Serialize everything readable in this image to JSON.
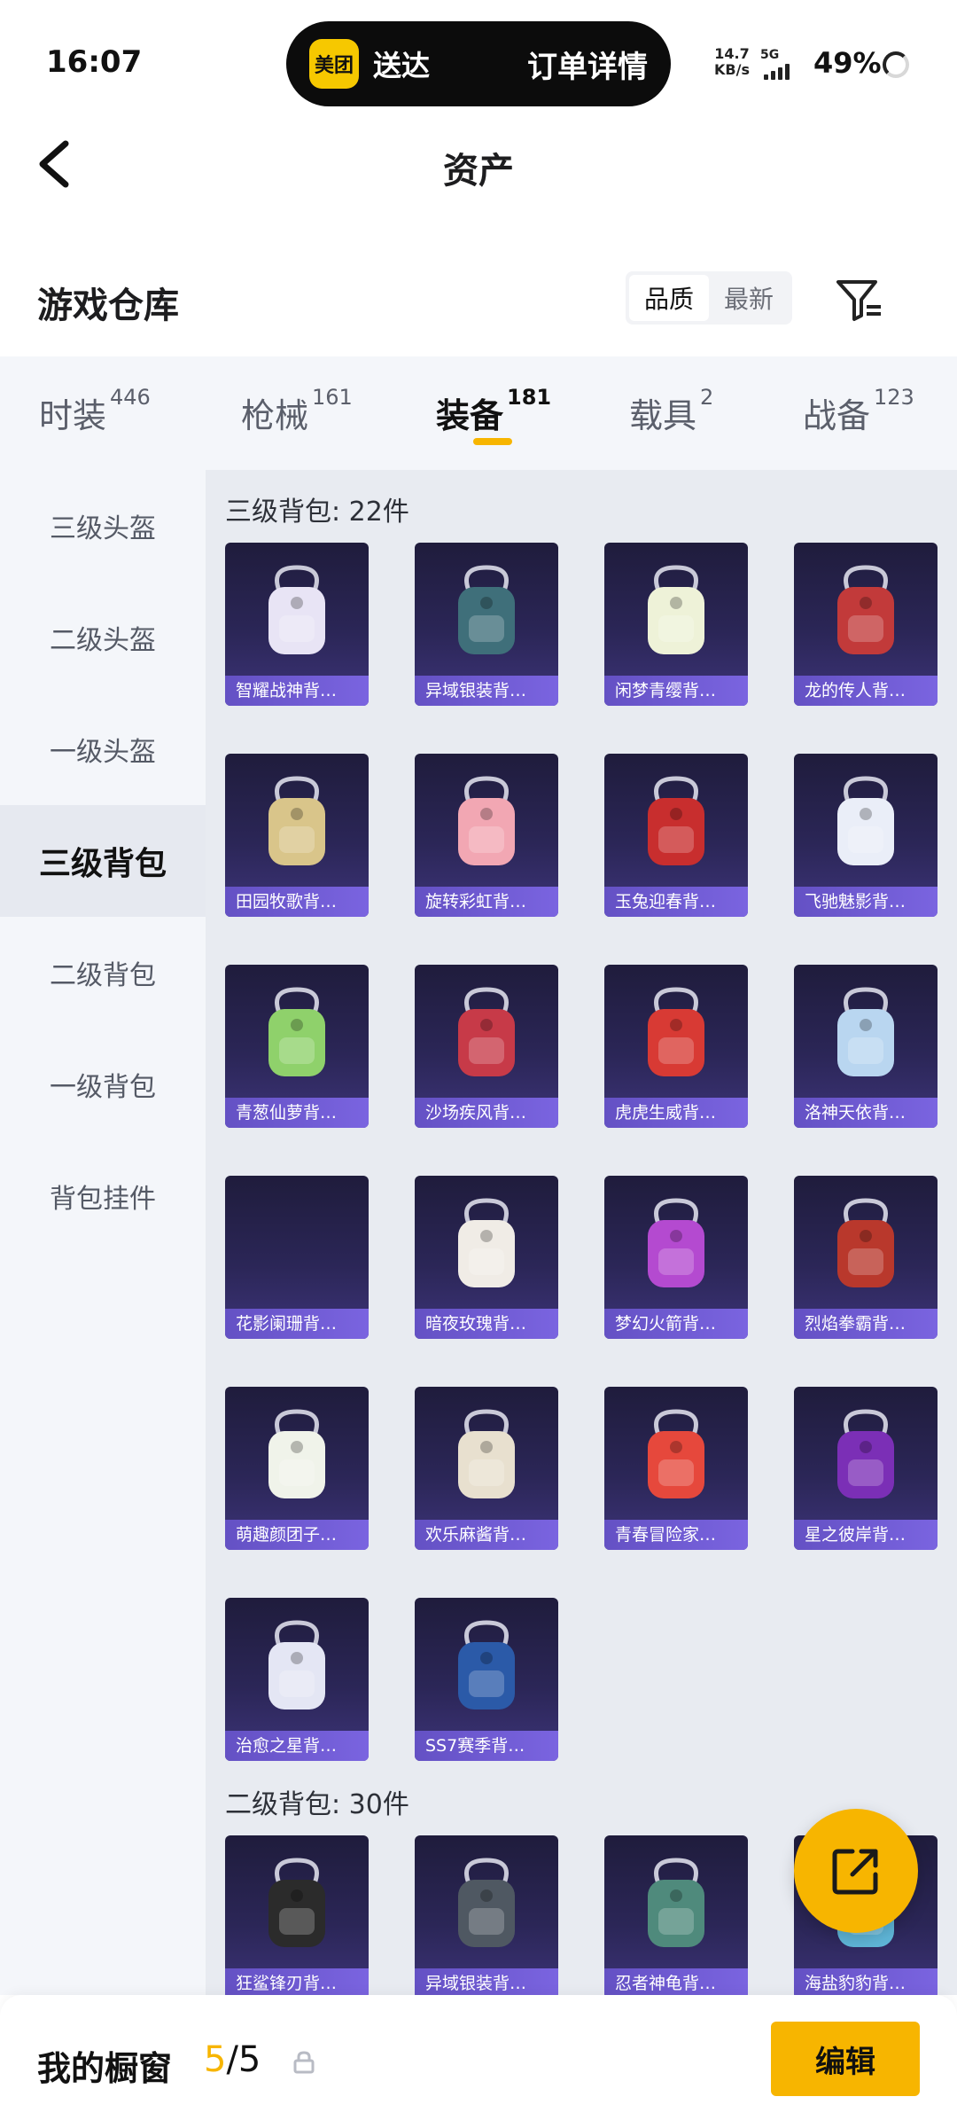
{
  "status_bar": {
    "time": "16:07",
    "island": {
      "logo": "美团",
      "text": "送达",
      "right": "订单详情"
    },
    "net_speed_value": "14.7",
    "net_speed_unit": "KB/s",
    "signal_type": "5G",
    "battery": "49%"
  },
  "header": {
    "title": "资产",
    "back_icon": "chevron-left-icon"
  },
  "warehouse": {
    "title": "游戏仓库",
    "sort_options": [
      "品质",
      "最新"
    ],
    "active_sort": "品质",
    "filter_icon": "filter-icon"
  },
  "tabs": [
    {
      "label": "时装",
      "count": "446"
    },
    {
      "label": "枪械",
      "count": "161"
    },
    {
      "label": "装备",
      "count": "181",
      "active": true
    },
    {
      "label": "载具",
      "count": "2"
    },
    {
      "label": "战备",
      "count": "123"
    }
  ],
  "sidebar": [
    {
      "label": "三级头盔"
    },
    {
      "label": "二级头盔"
    },
    {
      "label": "一级头盔"
    },
    {
      "label": "三级背包",
      "active": true
    },
    {
      "label": "二级背包"
    },
    {
      "label": "一级背包"
    },
    {
      "label": "背包挂件"
    }
  ],
  "sections": [
    {
      "title": "三级背包: 22件",
      "items": [
        "智耀战神背…",
        "异域银装背…",
        "闲梦青缨背…",
        "龙的传人背…",
        "田园牧歌背…",
        "旋转彩虹背…",
        "玉兔迎春背…",
        "飞驰魅影背…",
        "青葱仙萝背…",
        "沙场疾风背…",
        "虎虎生威背…",
        "洛神天依背…",
        "花影阑珊背…",
        "暗夜玫瑰背…",
        "梦幻火箭背…",
        "烈焰拳霸背…",
        "萌趣颜团子…",
        "欢乐麻酱背…",
        "青春冒险家…",
        "星之彼岸背…",
        "治愈之星背…",
        "SS7赛季背…"
      ]
    },
    {
      "title": "二级背包: 30件",
      "items": [
        "狂鲨锋刃背…",
        "异域银装背…",
        "忍者神龟背…",
        "海盐豹豹背…"
      ]
    }
  ],
  "card_colors": [
    "#e8e4f5",
    "#3f6f7a",
    "#eef2d8",
    "#c23a3a",
    "#d9c58a",
    "#f2a7b3",
    "#c82e2e",
    "#eaeef8",
    "#8fd16b",
    "#c73a48",
    "#d83a34",
    "#b9d6f0",
    "#2a2550",
    "#f0ece6",
    "#b44ad0",
    "#b9382c",
    "#f0f3ea",
    "#e8e0cf",
    "#e6483c",
    "#7b2fb6",
    "#e4e6f4",
    "#2b5aa8",
    "#2b2b2b",
    "#4f5862",
    "#4f8a7c",
    "#5fb6d8"
  ],
  "fab_icon": "external-link-icon",
  "bottom": {
    "label": "我的橱窗",
    "count_current": "5",
    "count_total": "/5",
    "lock_icon": "lock-icon",
    "edit": "编辑"
  }
}
